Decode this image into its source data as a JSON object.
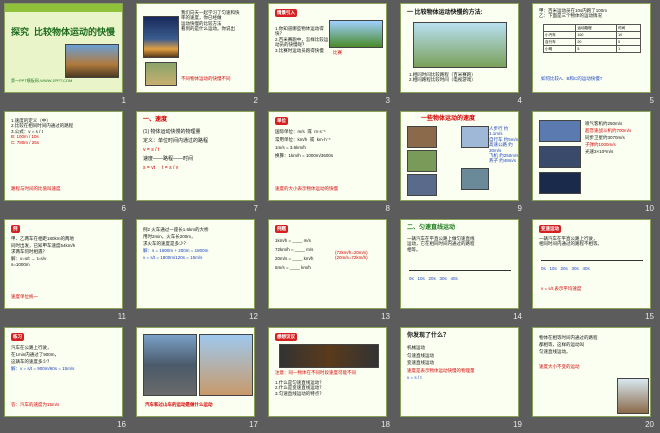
{
  "slides": [
    {
      "num": "1",
      "title": "探究  比较物体运动的快慢",
      "footer": "第一PPT模板网-WWW.1PPT.COM"
    },
    {
      "num": "2",
      "lines": [
        "我们向天一起学习了匀速和快",
        "率的速度，你已经做",
        "运动快慢的比较方法",
        "看到的是什么运动。你说出"
      ],
      "red": "不同物体运动的快慢不同"
    },
    {
      "num": "3",
      "badge": "情景引入",
      "lines": [
        "1.你知道哪些物体运动得快？",
        "2.百米赛跑中，怎样比较运",
        "动员的快慢呢？",
        "3.比赛时运动员跑得快慢"
      ],
      "red": "比赛"
    },
    {
      "num": "4",
      "title": "一 比较物体运动快慢的方法:",
      "lines": [
        "1.相同时间比较路程（百米赛跑）",
        "2.相同路程比较时间（电视游戏）"
      ]
    },
    {
      "num": "5",
      "lines": [
        "甲：百米运动员在10s内跑了100m",
        "乙：下面是三个物体的运动情况"
      ],
      "table": [
        [
          "",
          "运动路程",
          "时间"
        ],
        [
          "小汽车",
          "100",
          "10"
        ],
        [
          "自行车",
          "20",
          "5"
        ],
        [
          "小明",
          "5",
          "1"
        ]
      ],
      "footer": "如何比较A、B和C的运动快慢?"
    },
    {
      "num": "6",
      "lines": [
        "1.速度的定义（中）",
        "2.比较在相同时间内通过的路程",
        "3.公式：v = s / t",
        "B: 100m / 10s",
        "C: 780m / 25s"
      ],
      "red": "路程与时间的比值叫速度"
    },
    {
      "num": "7",
      "title": "一、速度",
      "lines": [
        "(1) 物体运动快慢的物理量",
        "定义：单位时间内通过的路程",
        "v = s / t",
        "速度——路程——时间",
        "s = vt     t = s / v"
      ]
    },
    {
      "num": "8",
      "badge": "单位",
      "lines": [
        "国际单位：m/s  或  m·s⁻¹",
        "常用单位：km/h  或  km·h⁻¹",
        "1m/s = 3.6km/h",
        "换算：1km/h = 1000m/3600s"
      ],
      "red": "速度的大小表示物体运动的快慢"
    },
    {
      "num": "9",
      "title": "一些物体运动的速度",
      "labels": [
        "人步行 约1.1m/s",
        "自行车 约5m/s",
        "高速公路 约30m/s",
        "飞机 约250m/s",
        "燕子 约48m/s"
      ]
    },
    {
      "num": "10",
      "labels": [
        "喷气客机约250m/s",
        "超音速战斗机约700m/s",
        "同步卫星约3070m/s",
        "子弹约1000m/s",
        "光速3×10⁸m/s"
      ]
    },
    {
      "num": "11",
      "badge": "例",
      "lines": [
        "甲、乙两车在相距180km的两地",
        "同时出发，已知甲车速度54km/h",
        "求两车何时相遇？",
        "解：v=s/t → t=s/v",
        "s=1000m"
      ],
      "red": "速度单位统一"
    },
    {
      "num": "12",
      "lines": [
        "例2 火车通过一座长1.6km的大桥",
        "用时2min，火车长200m，",
        "求火车的速度是多少？",
        "解：s = 1600m + 200m = 1800m",
        "v = s/t = 1800m/120s = 15m/s"
      ]
    },
    {
      "num": "13",
      "badge": "例题",
      "lines": [
        "1km/h = ____ m/s",
        "72km/h = ____ m/s",
        "20m/s = ____ km/h",
        "5m/s = ____ km/h"
      ],
      "answers": [
        "(72km/h=20m/s)",
        "(20m/s=72km/h)"
      ]
    },
    {
      "num": "14",
      "title": "二、匀速直线运动",
      "lines": [
        "一辆汽车在平直公路上做匀速直线",
        "运动，它在相同时间内通过的路程",
        "相等。",
        "0s   10s   20s   30s   40s"
      ]
    },
    {
      "num": "15",
      "badge": "变速运动",
      "lines": [
        "一辆汽车在平直公路上行驶，",
        "相同时间内通过的路程不相等。",
        "0s   10s   20s   30s   40s",
        "v = s/t 表示平均速度"
      ]
    },
    {
      "num": "16",
      "badge": "练习",
      "lines": [
        "汽车在公路上行驶，",
        "在1min内通过了900m，",
        "这辆车的速度多少？",
        "解：v = s/t = 900m/60s = 15m/s"
      ],
      "red": "答：汽车的速度为15m/s"
    },
    {
      "num": "17",
      "footer": "汽车和过山车的运动是做什么运动"
    },
    {
      "num": "18",
      "badge": "想想议议",
      "lines": [
        "1.什么是匀速直线运动？",
        "2.什么是变速直线运动？",
        "3.匀速直线运动的特点？"
      ],
      "red": "注意：同一物体在不同时段速度可能不同"
    },
    {
      "num": "19",
      "title": "你发现了什么？",
      "lines": [
        "机械运动",
        "匀速直线运动",
        "变速直线运动",
        "速度是表示物体运动快慢的物理量",
        "v = s / t"
      ]
    },
    {
      "num": "20",
      "lines": [
        "物体在相等时间内通过的路程",
        "都相等，这样的运动叫",
        "匀速直线运动。"
      ],
      "red": "速度大小不变的运动"
    }
  ],
  "colors": {
    "accent": "#1c7a1c",
    "red": "#d40000",
    "blue": "#1a3fbf"
  }
}
